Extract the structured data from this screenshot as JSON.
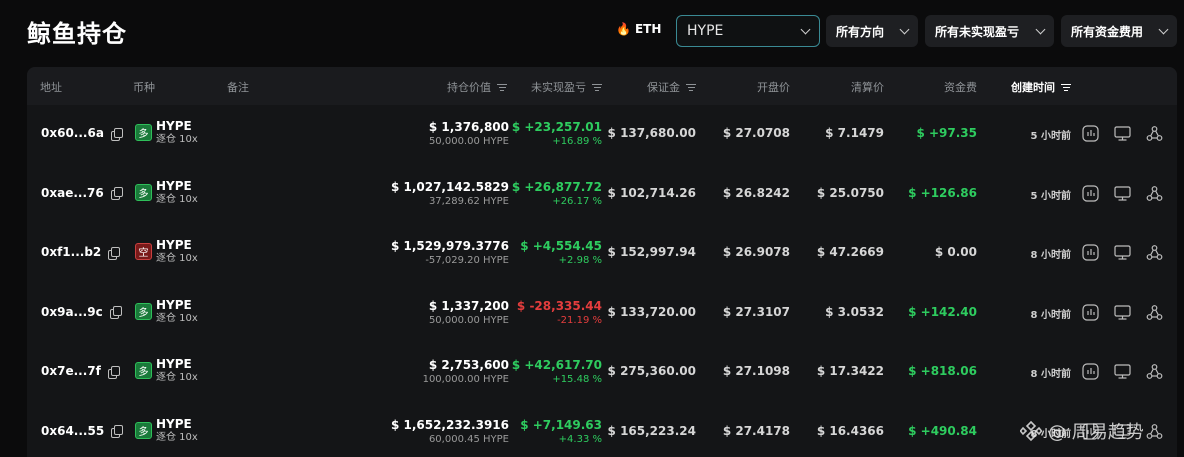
{
  "page_title": "鲸鱼持仓",
  "eth_tag": "ETH",
  "filters": {
    "coin": "HYPE",
    "direction": "所有方向",
    "pnl": "所有未实现盈亏",
    "funding": "所有资金费用"
  },
  "columns": {
    "address": "地址",
    "coin": "币种",
    "note": "备注",
    "value": "持仓价值",
    "upnl": "未实现盈亏",
    "margin": "保证金",
    "open": "开盘价",
    "liq": "清算价",
    "funding": "资金费",
    "created": "创建时间"
  },
  "rows": [
    {
      "address": "0x60...6a",
      "side": "多",
      "side_type": "long",
      "symbol": "HYPE",
      "leverage": "逐仓 10x",
      "value": "$ 1,376,800",
      "qty": "50,000.00 HYPE",
      "pnl": "$ +23,257.01",
      "pnl_pct": "+16.89 %",
      "pnl_sign": "pos",
      "margin": "$ 137,680.00",
      "open": "$ 27.0708",
      "liq": "$ 7.1479",
      "fee": "$ +97.35",
      "fee_sign": "pos",
      "time": "5 小时前"
    },
    {
      "address": "0xae...76",
      "side": "多",
      "side_type": "long",
      "symbol": "HYPE",
      "leverage": "逐仓 10x",
      "value": "$ 1,027,142.5829",
      "qty": "37,289.62 HYPE",
      "pnl": "$ +26,877.72",
      "pnl_pct": "+26.17 %",
      "pnl_sign": "pos",
      "margin": "$ 102,714.26",
      "open": "$ 26.8242",
      "liq": "$ 25.0750",
      "fee": "$ +126.86",
      "fee_sign": "pos",
      "time": "5 小时前"
    },
    {
      "address": "0xf1...b2",
      "side": "空",
      "side_type": "short",
      "symbol": "HYPE",
      "leverage": "逐仓 10x",
      "value": "$ 1,529,979.3776",
      "qty": "-57,029.20 HYPE",
      "pnl": "$ +4,554.45",
      "pnl_pct": "+2.98 %",
      "pnl_sign": "pos",
      "margin": "$ 152,997.94",
      "open": "$ 26.9078",
      "liq": "$ 47.2669",
      "fee": "$ 0.00",
      "fee_sign": "zero",
      "time": "8 小时前"
    },
    {
      "address": "0x9a...9c",
      "side": "多",
      "side_type": "long",
      "symbol": "HYPE",
      "leverage": "逐仓 10x",
      "value": "$ 1,337,200",
      "qty": "50,000.00 HYPE",
      "pnl": "$ -28,335.44",
      "pnl_pct": "-21.19 %",
      "pnl_sign": "neg",
      "margin": "$ 133,720.00",
      "open": "$ 27.3107",
      "liq": "$ 3.0532",
      "fee": "$ +142.40",
      "fee_sign": "pos",
      "time": "8 小时前"
    },
    {
      "address": "0x7e...7f",
      "side": "多",
      "side_type": "long",
      "symbol": "HYPE",
      "leverage": "逐仓 10x",
      "value": "$ 2,753,600",
      "qty": "100,000.00 HYPE",
      "pnl": "$ +42,617.70",
      "pnl_pct": "+15.48 %",
      "pnl_sign": "pos",
      "margin": "$ 275,360.00",
      "open": "$ 27.1098",
      "liq": "$ 17.3422",
      "fee": "$ +818.06",
      "fee_sign": "pos",
      "time": "8 小时前"
    },
    {
      "address": "0x64...55",
      "side": "多",
      "side_type": "long",
      "symbol": "HYPE",
      "leverage": "逐仓 10x",
      "value": "$ 1,652,232.3916",
      "qty": "60,000.45 HYPE",
      "pnl": "$ +7,149.63",
      "pnl_pct": "+4.33 %",
      "pnl_sign": "pos",
      "margin": "$ 165,223.24",
      "open": "$ 27.4178",
      "liq": "$ 16.4366",
      "fee": "$ +490.84",
      "fee_sign": "pos",
      "time": "8 小时前"
    }
  ],
  "watermark": "@ 周易趋势",
  "colors": {
    "positive": "#2ecc5f",
    "negative": "#e43d3d",
    "accent": "#3a8a94",
    "long": "#1a7a3a",
    "short": "#7a1a1a"
  },
  "icons": {
    "eth": "flame-icon",
    "row_actions": [
      "chart-icon",
      "monitor-icon",
      "network-icon"
    ]
  }
}
